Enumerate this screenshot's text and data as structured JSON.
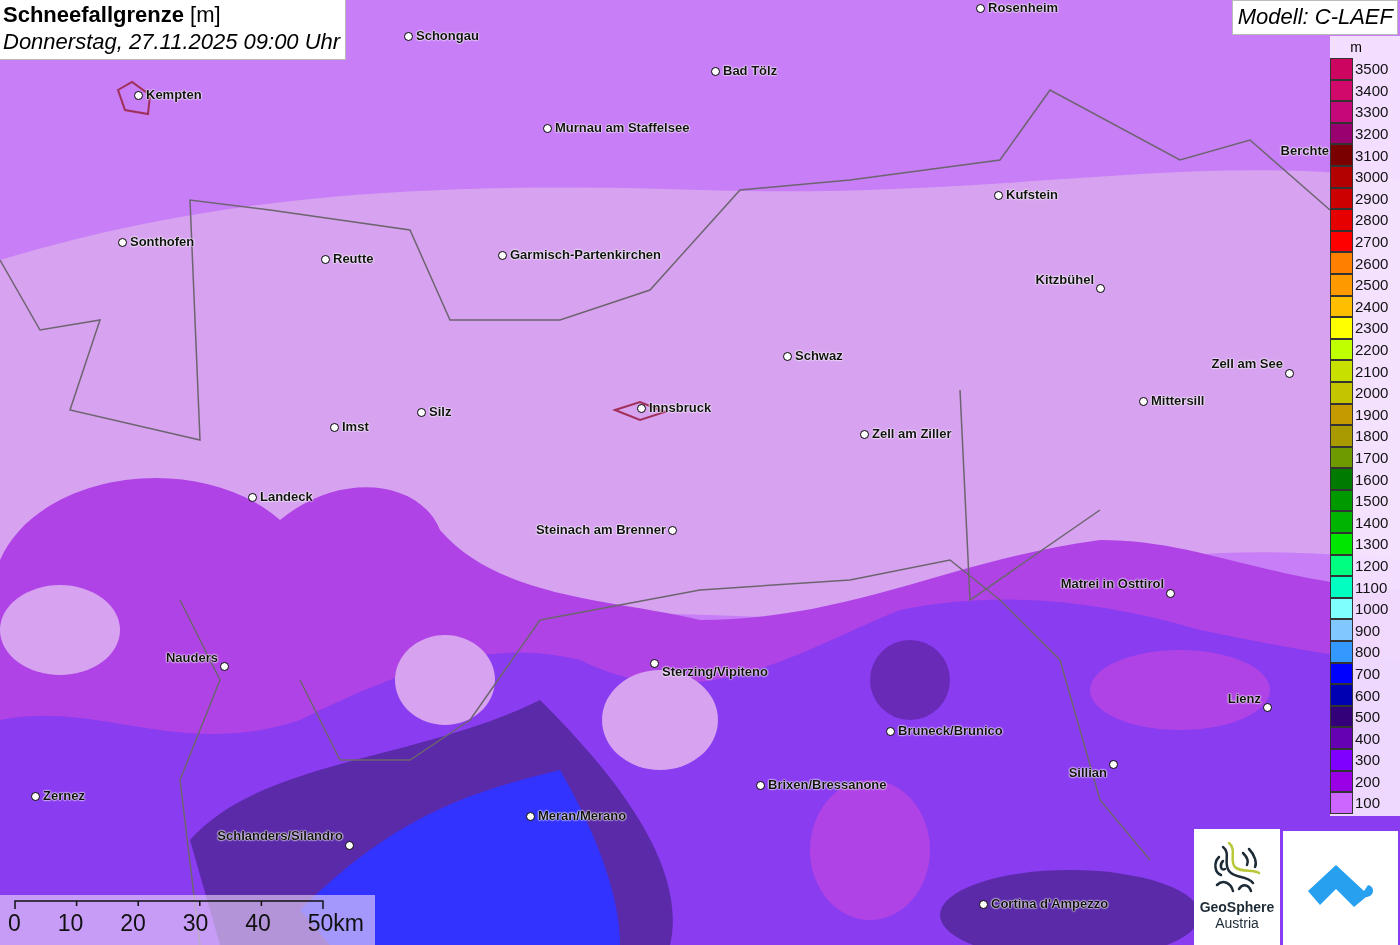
{
  "title": {
    "heading": "**Schneefallgrenze** [m]",
    "datetime": "Donnerstag, 27.11.2025 09:00 Uhr"
  },
  "model": "Modell: C-LAEF",
  "cities": [
    {
      "name": "Rosenheim"
    },
    {
      "name": "Schongau"
    },
    {
      "name": "Kempten"
    },
    {
      "name": "Bad Tölz"
    },
    {
      "name": "Murnau am Staffelsee"
    },
    {
      "name": "Berchte"
    },
    {
      "name": "Kufstein"
    },
    {
      "name": "Sonthofen"
    },
    {
      "name": "Reutte"
    },
    {
      "name": "Garmisch-Partenkirchen"
    },
    {
      "name": "Kitzbühel"
    },
    {
      "name": "Schwaz"
    },
    {
      "name": "Zell am See"
    },
    {
      "name": "Mittersill"
    },
    {
      "name": "Innsbruck"
    },
    {
      "name": "Silz"
    },
    {
      "name": "Imst"
    },
    {
      "name": "Zell am Ziller"
    },
    {
      "name": "Landeck"
    },
    {
      "name": "Steinach am Brenner"
    },
    {
      "name": "Matrei in Osttirol"
    },
    {
      "name": "Nauders"
    },
    {
      "name": "Sterzing/Vipiteno"
    },
    {
      "name": "Lienz"
    },
    {
      "name": "Bruneck/Brunico"
    },
    {
      "name": "Sillian"
    },
    {
      "name": "Brixen/Bressanone"
    },
    {
      "name": "Zernez"
    },
    {
      "name": "Meran/Merano"
    },
    {
      "name": "Schlanders/Silandro"
    },
    {
      "name": "Cortina d'Ampezzo"
    }
  ],
  "legend": {
    "unit": "m",
    "steps": [
      {
        "label": "3500",
        "color": "#cc0660"
      },
      {
        "label": "3400",
        "color": "#d1096b"
      },
      {
        "label": "3300",
        "color": "#c4087a"
      },
      {
        "label": "3200",
        "color": "#990070"
      },
      {
        "label": "3100",
        "color": "#7a0000"
      },
      {
        "label": "3000",
        "color": "#b30000"
      },
      {
        "label": "2900",
        "color": "#cc0000"
      },
      {
        "label": "2800",
        "color": "#e60000"
      },
      {
        "label": "2700",
        "color": "#ff0000"
      },
      {
        "label": "2600",
        "color": "#ff8000"
      },
      {
        "label": "2500",
        "color": "#ff9900"
      },
      {
        "label": "2400",
        "color": "#ffbf00"
      },
      {
        "label": "2300",
        "color": "#ffff00"
      },
      {
        "label": "2200",
        "color": "#bfff00"
      },
      {
        "label": "2100",
        "color": "#c8e000"
      },
      {
        "label": "2000",
        "color": "#c4c400"
      },
      {
        "label": "1900",
        "color": "#c49a00"
      },
      {
        "label": "1800",
        "color": "#a89a00"
      },
      {
        "label": "1700",
        "color": "#6e9a00"
      },
      {
        "label": "1600",
        "color": "#007a00"
      },
      {
        "label": "1500",
        "color": "#009900"
      },
      {
        "label": "1400",
        "color": "#00b300"
      },
      {
        "label": "1300",
        "color": "#00e600"
      },
      {
        "label": "1200",
        "color": "#00ff80"
      },
      {
        "label": "1100",
        "color": "#00ffc0"
      },
      {
        "label": "1000",
        "color": "#80ffff"
      },
      {
        "label": "900",
        "color": "#80c8ff"
      },
      {
        "label": "800",
        "color": "#3399ff"
      },
      {
        "label": "700",
        "color": "#0000ff"
      },
      {
        "label": "600",
        "color": "#0000b3"
      },
      {
        "label": "500",
        "color": "#33007a"
      },
      {
        "label": "400",
        "color": "#6600b3"
      },
      {
        "label": "300",
        "color": "#8000ff"
      },
      {
        "label": "200",
        "color": "#9900e6"
      },
      {
        "label": "100",
        "color": "#cc66ff"
      }
    ]
  },
  "scale_bar": {
    "labels": [
      "0",
      "10",
      "20",
      "30",
      "40",
      "50km"
    ]
  },
  "logo": {
    "name": "GeoSphere",
    "subtitle": "Austria"
  }
}
